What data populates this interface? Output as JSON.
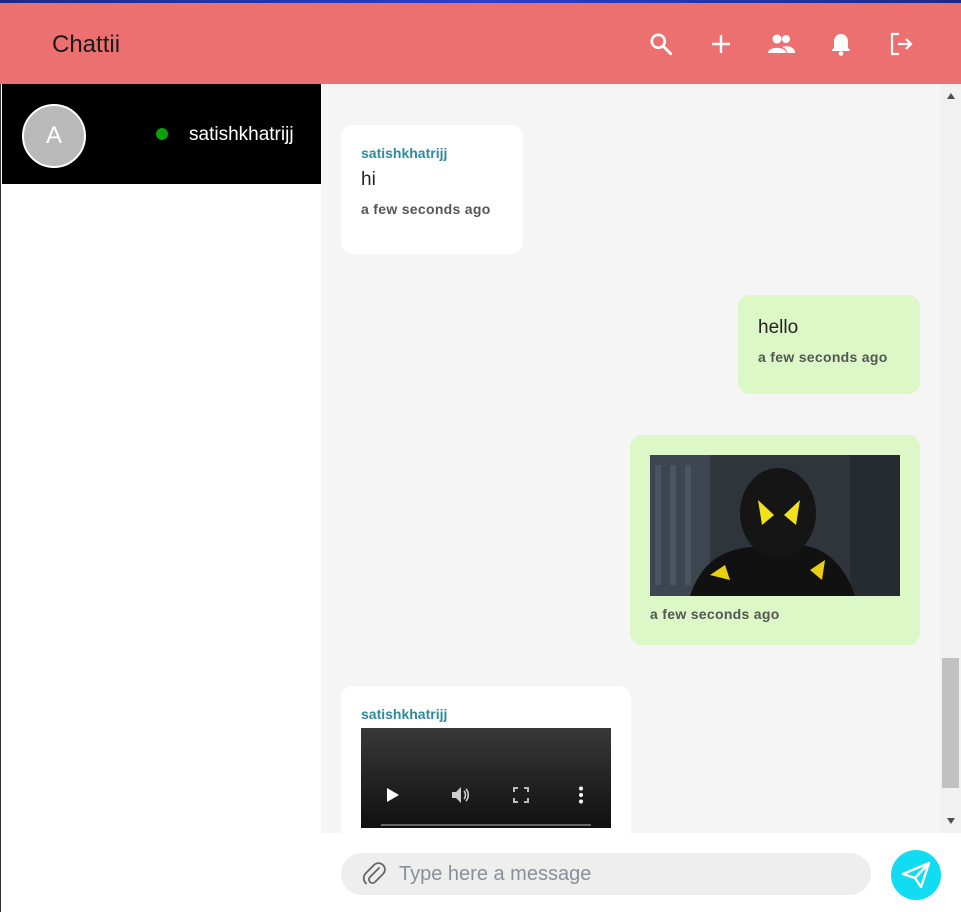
{
  "app": {
    "title": "Chattii"
  },
  "header": {
    "icons": [
      "search-icon",
      "add-icon",
      "group-icon",
      "notification-icon",
      "logout-icon"
    ]
  },
  "sidebar": {
    "contacts": [
      {
        "avatar_letter": "A",
        "name": "satishkhatrijj",
        "status": "online"
      }
    ]
  },
  "messages": [
    {
      "direction": "incoming",
      "sender": "satishkhatrijj",
      "type": "text",
      "text": "hi",
      "time": "a few seconds ago"
    },
    {
      "direction": "outgoing",
      "type": "text",
      "text": "hello",
      "time": "a few seconds ago"
    },
    {
      "direction": "outgoing",
      "type": "image",
      "time": "a few seconds ago"
    },
    {
      "direction": "incoming",
      "sender": "satishkhatrijj",
      "type": "video"
    }
  ],
  "composer": {
    "placeholder": "Type here a message"
  },
  "colors": {
    "header": "#ec7070",
    "incoming_bubble": "#ffffff",
    "outgoing_bubble": "#dcf8c6",
    "send_button": "#12dcf2",
    "sender_name": "#2f8a9e",
    "online": "#0aa10a"
  }
}
